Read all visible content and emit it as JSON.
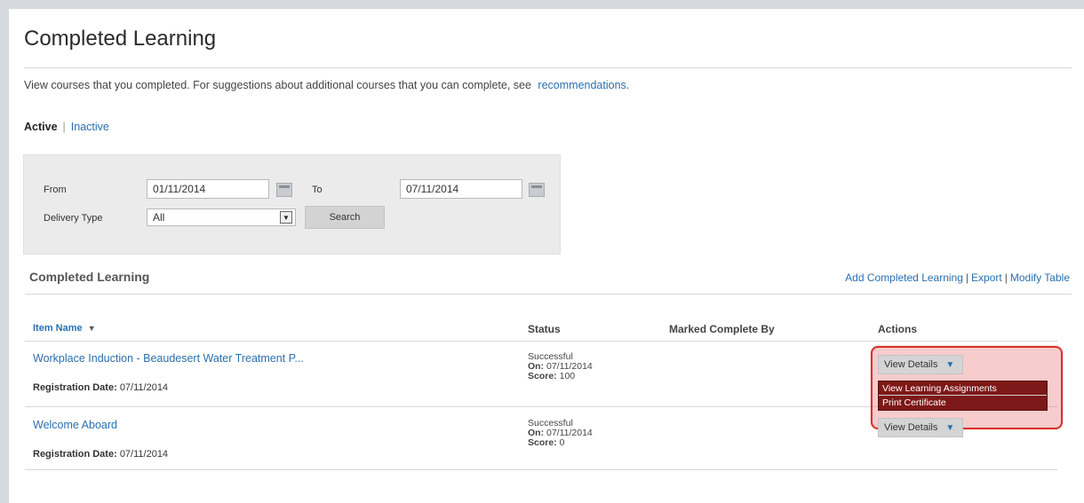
{
  "page": {
    "title": "Completed Learning",
    "intro_text": "View courses that you completed. For suggestions about additional courses that you can complete, see",
    "intro_link": "recommendations."
  },
  "status_tabs": {
    "active": "Active",
    "separator": "|",
    "inactive": "Inactive"
  },
  "filters": {
    "from_label": "From",
    "from_value": "01/11/2014",
    "to_label": "To",
    "to_value": "07/11/2014",
    "delivery_label": "Delivery Type",
    "delivery_value": "All",
    "search_label": "Search"
  },
  "section": {
    "title": "Completed Learning",
    "links": [
      "Add Completed Learning",
      "Export",
      "Modify Table"
    ],
    "link_separator": "|"
  },
  "table": {
    "headers": {
      "item_name": "Item Name",
      "status": "Status",
      "marked_by": "Marked Complete By",
      "actions": "Actions"
    },
    "rows": [
      {
        "item_name": "Workplace Induction - Beaudesert Water Treatment P...",
        "reg_label": "Registration Date:",
        "reg_date": "07/11/2014",
        "status": "Successful",
        "on_label": "On:",
        "on_date": "07/11/2014",
        "score_label": "Score:",
        "score": "100",
        "action_label": "View Details"
      },
      {
        "item_name": "Welcome Aboard",
        "reg_label": "Registration Date:",
        "reg_date": "07/11/2014",
        "status": "Successful",
        "on_label": "On:",
        "on_date": "07/11/2014",
        "score_label": "Score:",
        "score": "0",
        "action_label": "View Details"
      }
    ]
  },
  "dropdown_menu": {
    "items": [
      "View Learning Assignments",
      "Print Certificate"
    ]
  },
  "icons": {
    "calendar": "calendar-icon",
    "dropdown": "chevron-down-icon",
    "sort": "sort-down-icon"
  },
  "colors": {
    "link": "#2a6fb0",
    "highlight_border": "#d9302b",
    "menu_bg": "#7d1818",
    "filter_bg": "#ebebeb"
  }
}
